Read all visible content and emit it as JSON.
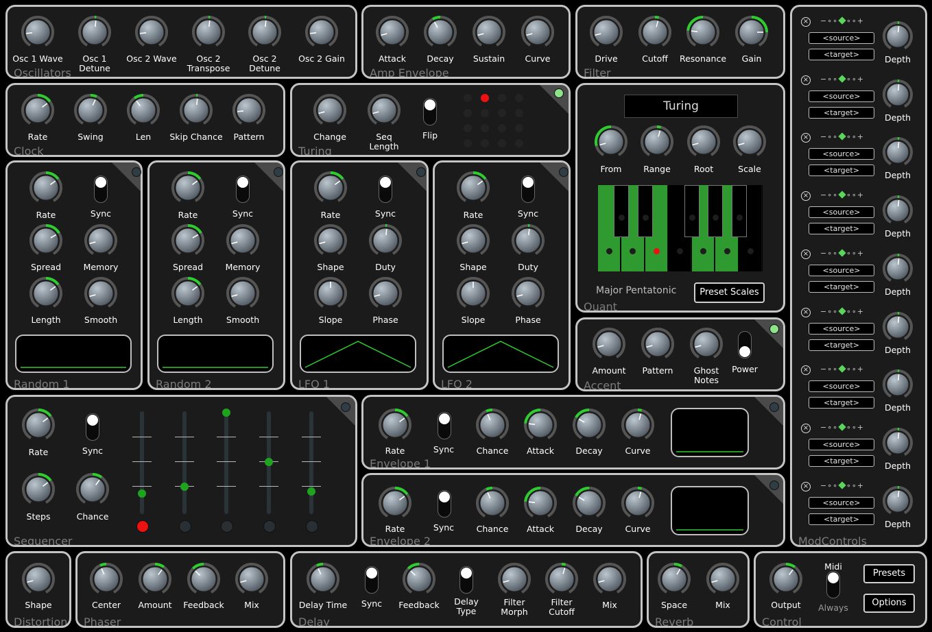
{
  "oscillators": {
    "title": "Oscillators",
    "knobs": [
      {
        "label": "Osc 1 Wave",
        "value": 0.18,
        "arc": false
      },
      {
        "label": "Osc 1\nDetune",
        "value": 0.52,
        "arc": true
      },
      {
        "label": "Osc 2 Wave",
        "value": 0.18,
        "arc": false
      },
      {
        "label": "Osc 2\nTranspose",
        "value": 0.52,
        "arc": true
      },
      {
        "label": "Osc 2\nDetune",
        "value": 0.52,
        "arc": true
      },
      {
        "label": "Osc 2 Gain",
        "value": 0.18,
        "arc": false
      }
    ]
  },
  "amp_envelope": {
    "title": "Amp Envelope",
    "knobs": [
      {
        "label": "Attack",
        "value": 0.15,
        "arc": false
      },
      {
        "label": "Decay",
        "value": 0.4,
        "arc": true
      },
      {
        "label": "Sustain",
        "value": 0.15,
        "arc": false
      },
      {
        "label": "Curve",
        "value": 0.15,
        "arc": false
      }
    ]
  },
  "filter": {
    "title": "Filter",
    "knobs": [
      {
        "label": "Drive",
        "value": 0.15,
        "arc": false
      },
      {
        "label": "Cutoff",
        "value": 0.55,
        "arc": true
      },
      {
        "label": "Resonance",
        "value": 0.22,
        "arc": true
      },
      {
        "label": "Gain",
        "value": 0.8,
        "arc": true
      }
    ]
  },
  "clock": {
    "title": "Clock",
    "knobs": [
      {
        "label": "Rate",
        "value": 0.68,
        "arc": true
      },
      {
        "label": "Swing",
        "value": 0.58,
        "arc": true
      },
      {
        "label": "Len",
        "value": 0.38,
        "arc": true
      },
      {
        "label": "Skip Chance",
        "value": 0.52,
        "arc": true
      },
      {
        "label": "Pattern",
        "value": 0.18,
        "arc": false
      }
    ]
  },
  "turing": {
    "title": "Turing",
    "knobs": [
      {
        "label": "Change",
        "value": 0.15,
        "arc": false
      },
      {
        "label": "Seq\nLength",
        "value": 0.15,
        "arc": false
      }
    ],
    "flip_label": "Flip"
  },
  "quant": {
    "title": "Quant",
    "display": "Turing",
    "knobs": [
      {
        "label": "From",
        "value": 0.15,
        "arc": true
      },
      {
        "label": "Range",
        "value": 0.55,
        "arc": true
      },
      {
        "label": "Root",
        "value": 0.15,
        "arc": false
      },
      {
        "label": "Scale",
        "value": 0.15,
        "arc": false
      }
    ],
    "scale_name": "Major Pentatonic",
    "preset_button": "Preset Scales"
  },
  "lfo_panels": [
    {
      "title": "Random 1",
      "labels": [
        "Rate",
        "Sync",
        "Spread",
        "Memory",
        "Length",
        "Smooth"
      ]
    },
    {
      "title": "Random 2",
      "labels": [
        "Rate",
        "Sync",
        "Spread",
        "Memory",
        "Length",
        "Smooth"
      ]
    },
    {
      "title": "LFO 1",
      "labels": [
        "Rate",
        "Sync",
        "Shape",
        "Duty",
        "Slope",
        "Phase"
      ]
    },
    {
      "title": "LFO 2",
      "labels": [
        "Rate",
        "Sync",
        "Shape",
        "Duty",
        "Slope",
        "Phase"
      ]
    }
  ],
  "accent": {
    "title": "Accent",
    "knobs": [
      {
        "label": "Amount",
        "value": 0.15,
        "arc": false
      },
      {
        "label": "Pattern",
        "value": 0.15,
        "arc": false
      },
      {
        "label": "Ghost\nNotes",
        "value": 0.15,
        "arc": false
      }
    ],
    "power_label": "Power"
  },
  "sequencer": {
    "title": "Sequencer",
    "labels": [
      "Rate",
      "Sync",
      "Steps",
      "Chance"
    ],
    "sliders": [
      0.18,
      0.25,
      1.0,
      0.5,
      0.2
    ]
  },
  "envelopes": [
    {
      "title": "Envelope 1",
      "labels": [
        "Rate",
        "Sync",
        "Chance",
        "Attack",
        "Decay",
        "Curve"
      ]
    },
    {
      "title": "Envelope 2",
      "labels": [
        "Rate",
        "Sync",
        "Chance",
        "Attack",
        "Decay",
        "Curve"
      ]
    }
  ],
  "mod_controls": {
    "title": "ModControls",
    "source": "<source>",
    "target": "<target>",
    "depth": "Depth",
    "slots": 9
  },
  "distortion": {
    "title": "Distortion",
    "knobs": [
      {
        "label": "Shape",
        "value": 0.15,
        "arc": false
      }
    ]
  },
  "phaser": {
    "title": "Phaser",
    "knobs": [
      {
        "label": "Center",
        "value": 0.42,
        "arc": true
      },
      {
        "label": "Amount",
        "value": 0.62,
        "arc": true
      },
      {
        "label": "Feedback",
        "value": 0.35,
        "arc": true
      },
      {
        "label": "Mix",
        "value": 0.15,
        "arc": false
      }
    ]
  },
  "delay": {
    "title": "Delay",
    "knobs": [
      {
        "label": "Delay Time",
        "value": 0.42,
        "arc": true
      },
      {
        "label": "Feedback",
        "value": 0.35,
        "arc": true
      },
      {
        "label": "Filter\nMorph",
        "value": 0.15,
        "arc": false
      },
      {
        "label": "Filter\nCutoff",
        "value": 0.55,
        "arc": true
      },
      {
        "label": "Mix",
        "value": 0.15,
        "arc": false
      }
    ],
    "sync_label": "Sync",
    "type_label": "Delay\nType"
  },
  "reverb": {
    "title": "Reverb",
    "knobs": [
      {
        "label": "Space",
        "value": 0.6,
        "arc": true
      },
      {
        "label": "Mix",
        "value": 0.15,
        "arc": false
      }
    ]
  },
  "control": {
    "title": "Control",
    "output": "Output",
    "midi": "Midi",
    "always": "Always",
    "presets": "Presets",
    "options": "Options"
  }
}
